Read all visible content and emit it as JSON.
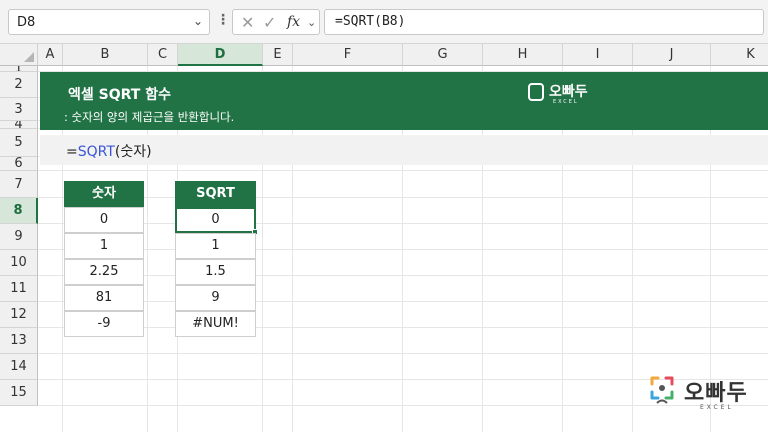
{
  "formula_bar": {
    "name_box": "D8",
    "dots": "⋮",
    "cancel_icon": "✕",
    "enter_icon": "✓",
    "fx_label": "fx",
    "formula": "=SQRT(B8)"
  },
  "columns": [
    "A",
    "B",
    "C",
    "D",
    "E",
    "F",
    "G",
    "H",
    "I",
    "J",
    "K"
  ],
  "selected_column": "D",
  "rows": [
    "1",
    "2",
    "3",
    "4",
    "5",
    "6",
    "7",
    "8",
    "9",
    "10",
    "11",
    "12",
    "13",
    "14",
    "15"
  ],
  "selected_row": "8",
  "banner": {
    "title": "엑셀 SQRT 함수",
    "subtitle": ": 숫자의 양의 제곱근을 반환합니다.",
    "logo_text": "오빠두",
    "logo_sub": "EXCEL"
  },
  "syntax": {
    "prefix": "=",
    "function_name": "SQRT",
    "args": "(숫자)"
  },
  "table_input": {
    "header": "숫자",
    "values": [
      "0",
      "1",
      "2.25",
      "81",
      "-9"
    ]
  },
  "table_output": {
    "header": "SQRT",
    "values": [
      "0",
      "1",
      "1.5",
      "9",
      "#NUM!"
    ]
  },
  "watermark": {
    "text": "오빠두",
    "sub": "EXCEL"
  },
  "colors": {
    "accent": "#217346",
    "function_blue": "#3a55d6"
  }
}
